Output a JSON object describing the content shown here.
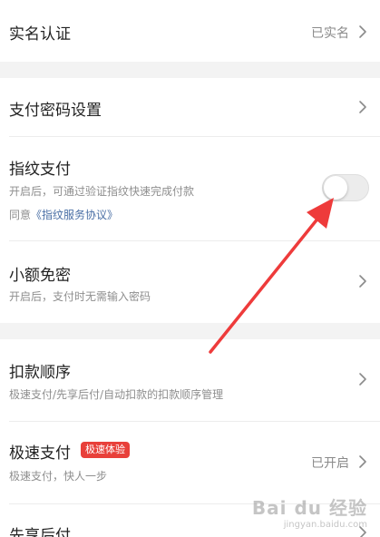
{
  "colors": {
    "background": "#f3f3f3",
    "card": "#ffffff",
    "badge": "#e8403a",
    "link": "#4a6fa5",
    "arrow": "#ee3b3b"
  },
  "rows": {
    "real_name": {
      "title": "实名认证",
      "value": "已实名"
    },
    "pay_password": {
      "title": "支付密码设置"
    },
    "fingerprint": {
      "title": "指纹支付",
      "desc": "开启后，可通过验证指纹快速完成付款",
      "agree_prefix": "同意",
      "agree_link": "《指纹服务协议》",
      "toggle_on": false
    },
    "small_free": {
      "title": "小额免密",
      "desc": "开启后，支付时无需输入密码"
    },
    "deduct_order": {
      "title": "扣款顺序",
      "desc": "极速支付/先享后付/自动扣款的扣款顺序管理"
    },
    "quick_pay": {
      "title": "极速支付",
      "badge": "极速体验",
      "desc": "极速支付，快人一步",
      "value": "已开启"
    },
    "pay_later": {
      "title": "先享后付"
    }
  },
  "watermark": {
    "main": "Bai du 经验",
    "sub": "jingyan.baidu.com"
  }
}
